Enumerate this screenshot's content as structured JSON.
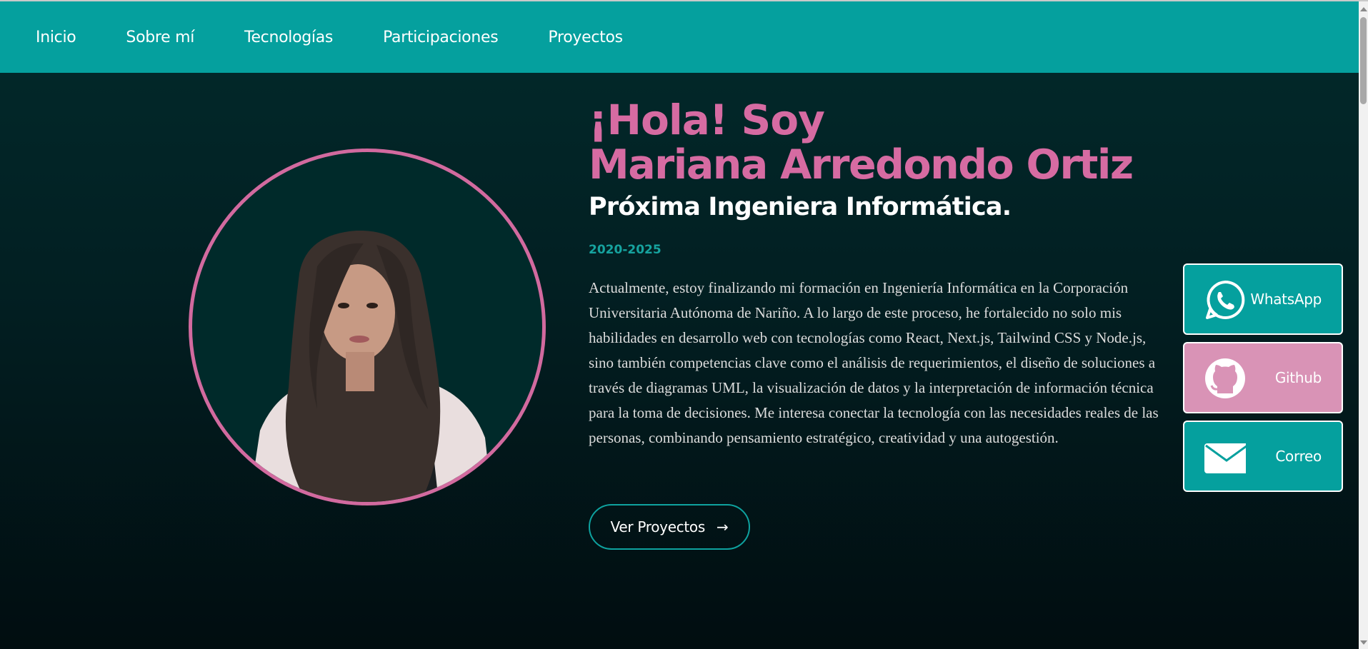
{
  "nav": {
    "items": [
      {
        "label": "Inicio"
      },
      {
        "label": "Sobre mí"
      },
      {
        "label": "Tecnologías"
      },
      {
        "label": "Participaciones"
      },
      {
        "label": "Proyectos"
      }
    ]
  },
  "hero": {
    "greeting": "¡Hola! Soy",
    "name": "Mariana Arredondo Ortiz",
    "role": "Próxima Ingeniera Informática.",
    "years": "2020-2025",
    "bio": "Actualmente, estoy finalizando mi formación en Ingeniería Informática en la Corporación Universitaria Autónoma de Nariño. A lo largo de este proceso, he fortalecido no solo mis habilidades en desarrollo web con tecnologías como React, Next.js, Tailwind CSS y Node.js, sino también competencias clave como el análisis de requerimientos, el diseño de soluciones a través de diagramas UML, la visualización de datos y la interpretación de información técnica para la toma de decisiones. Me interesa conectar la tecnología con las necesidades reales de las personas, combinando pensamiento estratégico, creatividad y una autogestión.",
    "cta_label": "Ver Proyectos",
    "cta_arrow": "→"
  },
  "social": {
    "whatsapp": {
      "label": "WhatsApp",
      "icon": "whatsapp-icon"
    },
    "github": {
      "label": "Github",
      "icon": "github-icon"
    },
    "mail": {
      "label": "Correo",
      "icon": "mail-icon"
    }
  },
  "colors": {
    "accent_teal": "#05a09e",
    "accent_pink": "#d66ba2",
    "github_pink": "#d993b6",
    "background_dark": "#021f22"
  }
}
